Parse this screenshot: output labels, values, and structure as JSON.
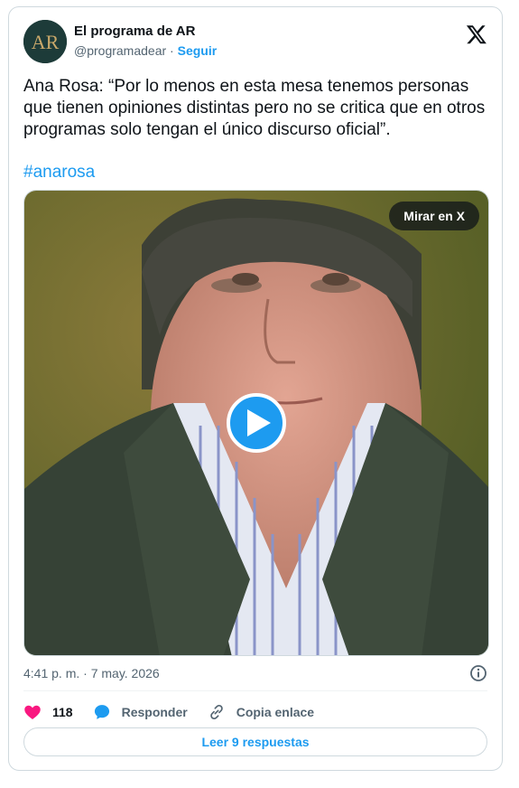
{
  "account": {
    "name": "El programa de AR",
    "handle": "@programadear",
    "separator": "·",
    "follow_label": "Seguir",
    "avatar_text": "AR"
  },
  "tweet": {
    "text": "Ana Rosa: “Por lo menos en esta mesa tenemos personas que tienen opiniones distintas pero no se critica que en otros programas solo tengan el único discurso oficial”.",
    "hashtag": "#anarosa",
    "timestamp": "4:41 p. m. · 7 may. 2026"
  },
  "media": {
    "watch_label": "Mirar en X",
    "type": "video"
  },
  "actions": {
    "like_count": "118",
    "reply_label": "Responder",
    "copy_label": "Copia enlace"
  },
  "replies_button": "Leer 9 respuestas",
  "colors": {
    "accent": "#1d9bf0",
    "like": "#f91880",
    "text": "#0f1419",
    "secondary": "#536471"
  }
}
